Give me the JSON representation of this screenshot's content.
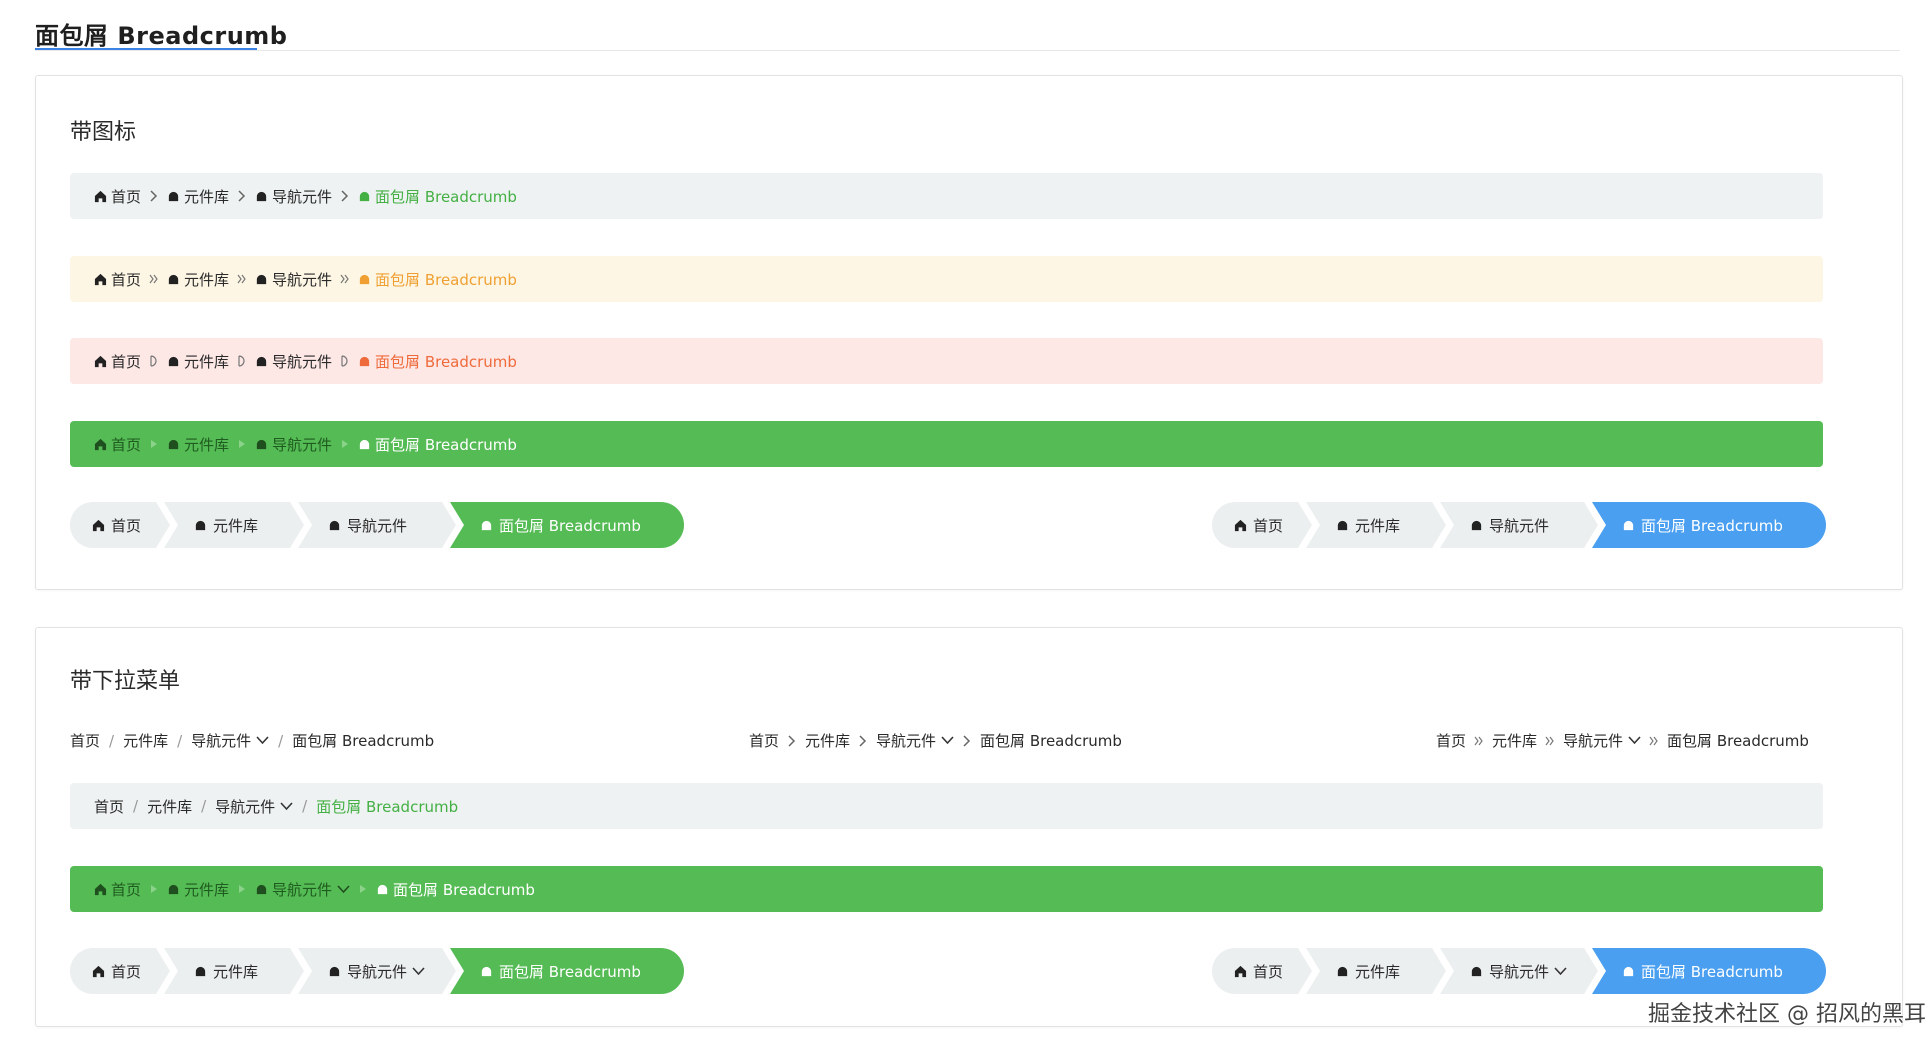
{
  "page": {
    "title": "面包屑 Breadcrumb"
  },
  "watermark": "掘金技术社区 @ 招风的黑耳",
  "colors": {
    "accent_green": "#55bb55",
    "accent_blue": "#4a9ff0",
    "link_green": "#44b044",
    "orange": "#f0a032",
    "red": "#ef6a3a",
    "title_underline": "#3a82e4"
  },
  "icons": {
    "home": "home-icon",
    "bell": "bell-shaped-icon",
    "chevron": "chevron-right-icon",
    "double_chevron": "double-chevron-icon",
    "dropdown": "chevron-down-icon"
  },
  "section1": {
    "title": "带图标",
    "bars": [
      {
        "style": "grey",
        "separator": "chevron",
        "items": [
          "首页",
          "元件库",
          "导航元件"
        ],
        "current": "面包屑 Breadcrumb"
      },
      {
        "style": "yellow",
        "separator": "double-chevron",
        "items": [
          "首页",
          "元件库",
          "导航元件"
        ],
        "current": "面包屑 Breadcrumb"
      },
      {
        "style": "red",
        "separator": "half-circle",
        "items": [
          "首页",
          "元件库",
          "导航元件"
        ],
        "current": "面包屑 Breadcrumb"
      },
      {
        "style": "green",
        "separator": "triangle",
        "items": [
          "首页",
          "元件库",
          "导航元件"
        ],
        "current": "面包屑 Breadcrumb"
      }
    ],
    "arrows_left": {
      "items": [
        "首页",
        "元件库",
        "导航元件"
      ],
      "current": "面包屑 Breadcrumb",
      "active_color": "green"
    },
    "arrows_right": {
      "items": [
        "首页",
        "元件库",
        "导航元件"
      ],
      "current": "面包屑 Breadcrumb",
      "active_color": "blue"
    }
  },
  "section2": {
    "title": "带下拉菜单",
    "inline": [
      {
        "separator": "/",
        "items": [
          "首页",
          "元件库",
          "导航元件"
        ],
        "current": "面包屑 Breadcrumb"
      },
      {
        "separator": ">",
        "items": [
          "首页",
          "元件库",
          "导航元件"
        ],
        "current": "面包屑 Breadcrumb"
      },
      {
        "separator": "»",
        "items": [
          "首页",
          "元件库",
          "导航元件"
        ],
        "current": "面包屑 Breadcrumb"
      }
    ],
    "bar_grey": {
      "items": [
        "首页",
        "元件库",
        "导航元件"
      ],
      "current": "面包屑 Breadcrumb"
    },
    "bar_green": {
      "items": [
        "首页",
        "元件库",
        "导航元件"
      ],
      "current": "面包屑 Breadcrumb"
    },
    "arrows_left": {
      "items": [
        "首页",
        "元件库",
        "导航元件"
      ],
      "current": "面包屑 Breadcrumb",
      "active_color": "green"
    },
    "arrows_right": {
      "items": [
        "首页",
        "元件库",
        "导航元件"
      ],
      "current": "面包屑 Breadcrumb",
      "active_color": "blue"
    }
  }
}
